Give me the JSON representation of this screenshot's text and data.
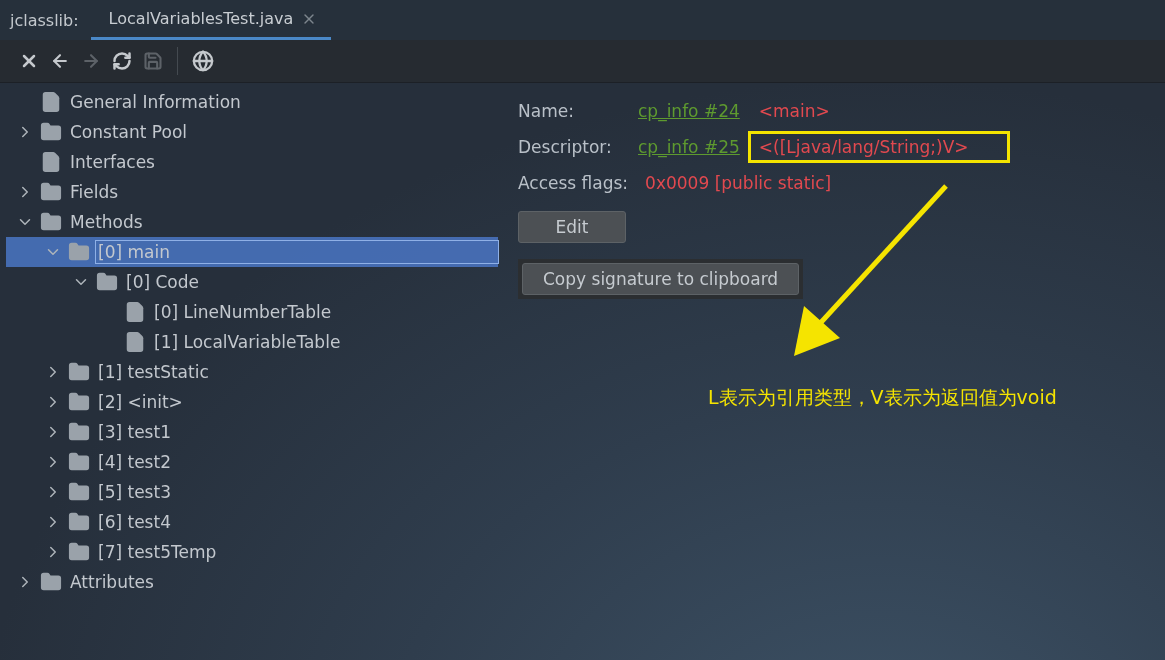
{
  "header": {
    "app_label": "jclasslib:",
    "tabs": [
      {
        "label": "LocalVariablesTest.java",
        "selected": true
      }
    ]
  },
  "toolbar": [
    {
      "kind": "close",
      "disabled": false
    },
    {
      "kind": "back",
      "disabled": false
    },
    {
      "kind": "forward",
      "disabled": true
    },
    {
      "kind": "refresh",
      "disabled": false
    },
    {
      "kind": "save",
      "disabled": true
    },
    {
      "kind": "separator"
    },
    {
      "kind": "globe",
      "disabled": false
    }
  ],
  "tree": [
    {
      "label": "General Information",
      "kind": "file",
      "selected": false
    },
    {
      "label": "Constant Pool",
      "kind": "folder",
      "expanded": false,
      "selected": false
    },
    {
      "label": "Interfaces",
      "kind": "file",
      "selected": false
    },
    {
      "label": "Fields",
      "kind": "folder",
      "expanded": false,
      "selected": false
    },
    {
      "label": "Methods",
      "kind": "folder",
      "expanded": true,
      "selected": false,
      "children": [
        {
          "label": "[0] main",
          "kind": "folder",
          "expanded": true,
          "selected": true,
          "children": [
            {
              "label": "[0] Code",
              "kind": "folder",
              "expanded": true,
              "selected": false,
              "children": [
                {
                  "label": "[0] LineNumberTable",
                  "kind": "file",
                  "selected": false
                },
                {
                  "label": "[1] LocalVariableTable",
                  "kind": "file",
                  "selected": false
                }
              ]
            }
          ]
        },
        {
          "label": "[1] testStatic",
          "kind": "folder",
          "expanded": false,
          "selected": false
        },
        {
          "label": "[2] <init>",
          "kind": "folder",
          "expanded": false,
          "selected": false
        },
        {
          "label": "[3] test1",
          "kind": "folder",
          "expanded": false,
          "selected": false
        },
        {
          "label": "[4] test2",
          "kind": "folder",
          "expanded": false,
          "selected": false
        },
        {
          "label": "[5] test3",
          "kind": "folder",
          "expanded": false,
          "selected": false
        },
        {
          "label": "[6] test4",
          "kind": "folder",
          "expanded": false,
          "selected": false
        },
        {
          "label": "[7] test5Temp",
          "kind": "folder",
          "expanded": false,
          "selected": false
        }
      ]
    },
    {
      "label": "Attributes",
      "kind": "folder",
      "expanded": false,
      "selected": false
    }
  ],
  "details": {
    "rows": [
      {
        "label": "Name:",
        "link": "cp_info #24",
        "value": "<main>",
        "highlighted": false
      },
      {
        "label": "Descriptor:",
        "link": "cp_info #25",
        "value": "<([Ljava/lang/String;)V>",
        "highlighted": true
      },
      {
        "label": "Access flags:",
        "value": "0x0009 [public static]",
        "highlighted": false
      }
    ],
    "buttons": [
      {
        "label": "Edit",
        "kind": "plain"
      },
      {
        "label": "Copy signature to clipboard",
        "kind": "panel"
      }
    ]
  },
  "annotation": {
    "text": "L表示为引用类型，V表示为返回值为void"
  }
}
